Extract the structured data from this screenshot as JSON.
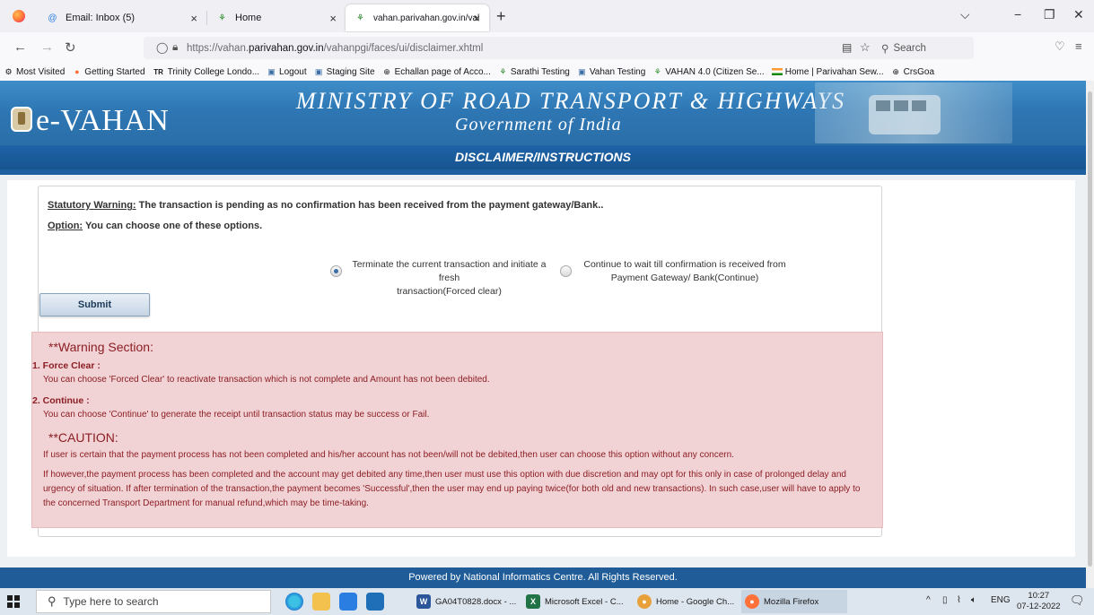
{
  "browser": {
    "tabs": [
      {
        "label": "Email: Inbox (5)",
        "icon": "email-icon"
      },
      {
        "label": "Home",
        "icon": "vahan-icon"
      },
      {
        "label": "vahan.parivahan.gov.in/vahanp",
        "icon": "vahan-icon"
      }
    ],
    "url_prefix": "https://vahan.",
    "url_domain": "parivahan.gov.in",
    "url_path": "/vahanpgi/faces/ui/disclaimer.xhtml",
    "search_placeholder": "Search",
    "bookmarks": [
      "Most Visited",
      "Getting Started",
      "Trinity College Londo...",
      "Logout",
      "Staging Site",
      "Echallan page of Acco...",
      "Sarathi Testing",
      "Vahan Testing",
      "VAHAN 4.0 (Citizen Se...",
      "Home | Parivahan Sew...",
      "CrsGoa"
    ],
    "tr_label": "TR"
  },
  "header": {
    "brand": "e-VAHAN",
    "ministry": "MINISTRY OF ROAD TRANSPORT & HIGHWAYS",
    "government": "Government of India",
    "page_title": "DISCLAIMER/INSTRUCTIONS"
  },
  "form": {
    "warning_label": "Statutory Warning:",
    "warning_text": " The transaction is pending as no confirmation has been received from the payment gateway/Bank..",
    "option_label": "Option:",
    "option_text": " You can choose one of these options.",
    "radio_options": [
      {
        "line1": "Terminate the current transaction and initiate a fresh",
        "line2": "transaction(Forced clear)",
        "selected": true
      },
      {
        "line1": "Continue to wait till confirmation is received from",
        "line2": "Payment Gateway/ Bank(Continue)",
        "selected": false
      }
    ],
    "submit_label": "Submit"
  },
  "warning_section": {
    "title": "**Warning Section:",
    "items": [
      {
        "title": "1. Force Clear :",
        "text": "You can choose 'Forced Clear' to reactivate transaction which is not complete and Amount has not been debited."
      },
      {
        "title": "2. Continue :",
        "text": "You can choose 'Continue' to generate the receipt until transaction status may be success or Fail."
      }
    ],
    "caution_title": "**CAUTION:",
    "caution_para1": "If user is certain that the payment process has not been completed and his/her account has not been/will not be debited,then user can choose this option without any concern.",
    "caution_para2": "If however,the payment process has been completed and the account may get debited any time,then user must use this option with due discretion and may opt for this only in case of prolonged delay and urgency of situation. If after termination of the transaction,the payment becomes 'Successful',then the user may end up paying twice(for both old and new transactions). In such case,user will have to apply to the concerned Transport Department for manual refund,which may be time-taking."
  },
  "footer": {
    "text": "Powered by National Informatics Centre. All Rights Reserved."
  },
  "taskbar": {
    "search_placeholder": "Type here to search",
    "apps": [
      {
        "label": "GA04T0828.docx - ...",
        "color": "#2b579a",
        "glyph": "W"
      },
      {
        "label": "Microsoft Excel - C...",
        "color": "#217346",
        "glyph": "X"
      },
      {
        "label": "Home - Google Ch...",
        "color": "#e8a13a",
        "glyph": "●"
      },
      {
        "label": "Mozilla Firefox",
        "color": "#ff7139",
        "glyph": "●"
      }
    ],
    "lang": "ENG",
    "time": "10:27",
    "date": "07-12-2022"
  }
}
